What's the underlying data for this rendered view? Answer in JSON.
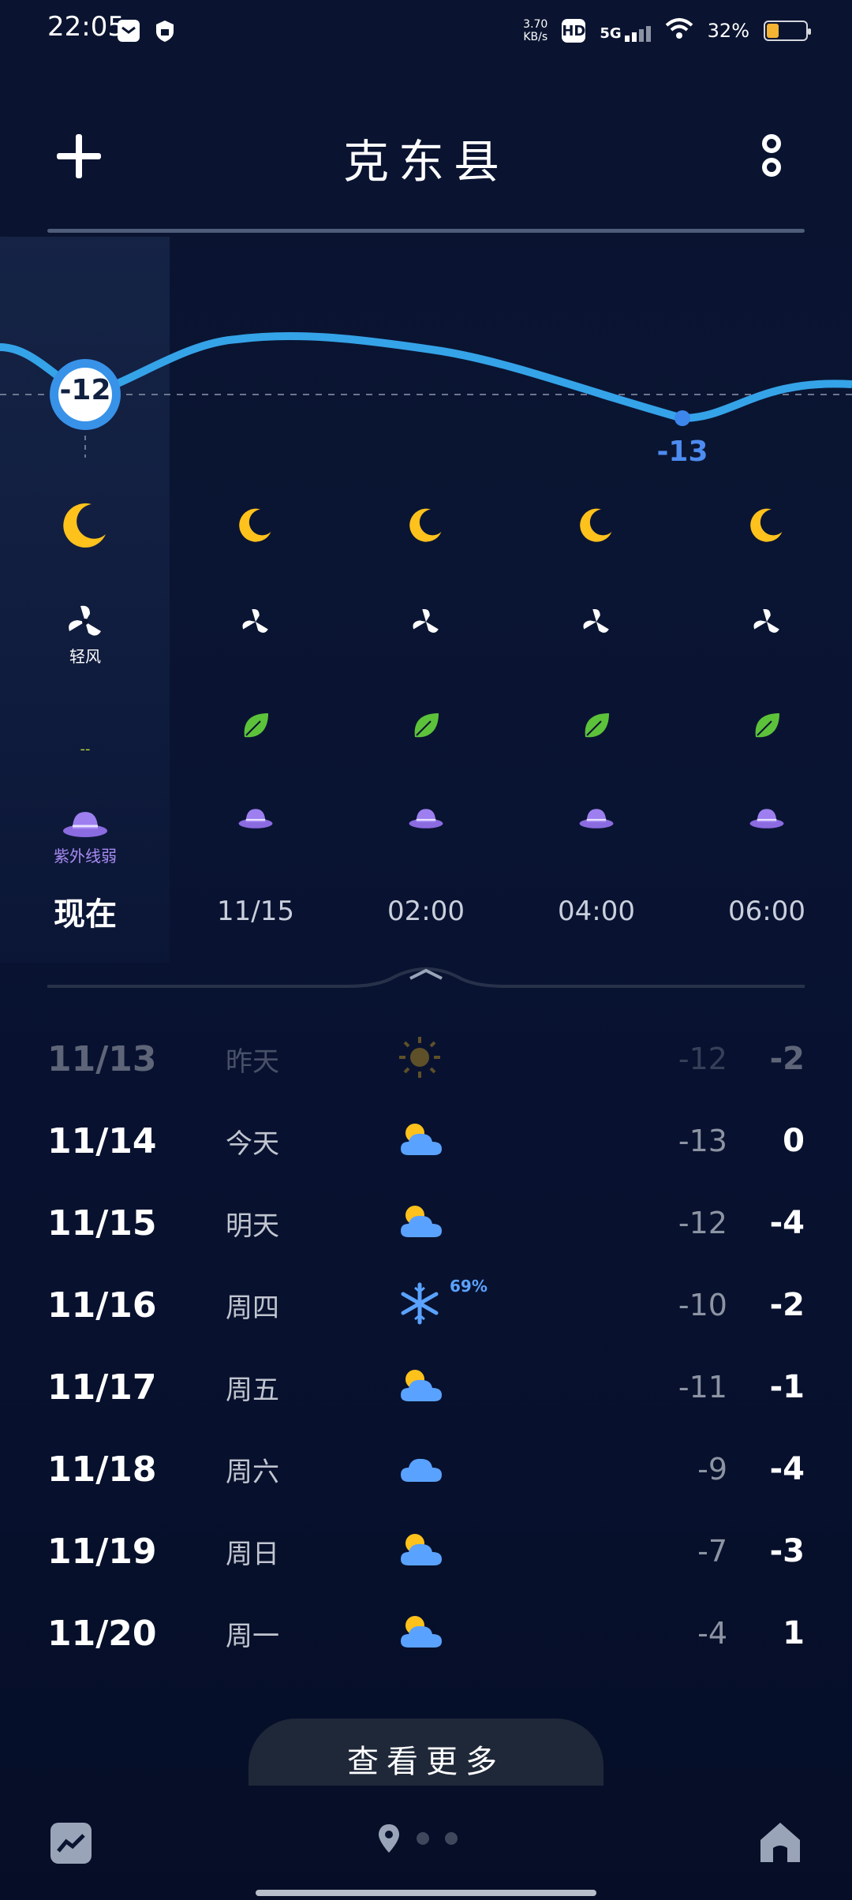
{
  "status_bar": {
    "time": "22:05",
    "net_speed_value": "3.70",
    "net_speed_unit": "KB/s",
    "hd": "HD",
    "network": "5G",
    "battery": "32%",
    "battery_level": 0.32
  },
  "header": {
    "add_icon": "plus-icon",
    "city": "克东县",
    "menu_icon": "more-vertical-icon"
  },
  "hourly": {
    "temp_now": "-12",
    "temp_min": "-13",
    "wind_now_label": "轻风",
    "aqi_now_label": "--",
    "uv_now_label": "紫外线弱",
    "times": [
      "现在",
      "11/15",
      "02:00",
      "04:00",
      "06:00"
    ],
    "weather_icon": "moon-icon",
    "wind_icon": "fan-icon",
    "aqi_icon": "leaf-icon",
    "uv_icon": "hat-icon"
  },
  "daily": [
    {
      "date": "11/13",
      "name": "昨天",
      "icon": "sun-icon",
      "low": "-12",
      "high": "-2",
      "past": true
    },
    {
      "date": "11/14",
      "name": "今天",
      "icon": "partly-cloudy-icon",
      "low": "-13",
      "high": "0"
    },
    {
      "date": "11/15",
      "name": "明天",
      "icon": "partly-cloudy-icon",
      "low": "-12",
      "high": "-4"
    },
    {
      "date": "11/16",
      "name": "周四",
      "icon": "snow-icon",
      "pct": "69%",
      "low": "-10",
      "high": "-2"
    },
    {
      "date": "11/17",
      "name": "周五",
      "icon": "partly-cloudy-icon",
      "low": "-11",
      "high": "-1"
    },
    {
      "date": "11/18",
      "name": "周六",
      "icon": "cloud-icon",
      "low": "-9",
      "high": "-4"
    },
    {
      "date": "11/19",
      "name": "周日",
      "icon": "partly-cloudy-icon",
      "low": "-7",
      "high": "-3"
    },
    {
      "date": "11/20",
      "name": "周一",
      "icon": "partly-cloudy-icon",
      "low": "-4",
      "high": "1"
    }
  ],
  "more_button": "查看更多",
  "bottom_nav": {
    "left_icon": "trend-chart-icon",
    "location_icon": "location-pin-icon",
    "right_icon": "home-icon"
  },
  "colors": {
    "background": "#0a1430",
    "curve": "#3aa6f0",
    "accent_blue": "#4d8cf0",
    "sun": "#ffc21c"
  }
}
